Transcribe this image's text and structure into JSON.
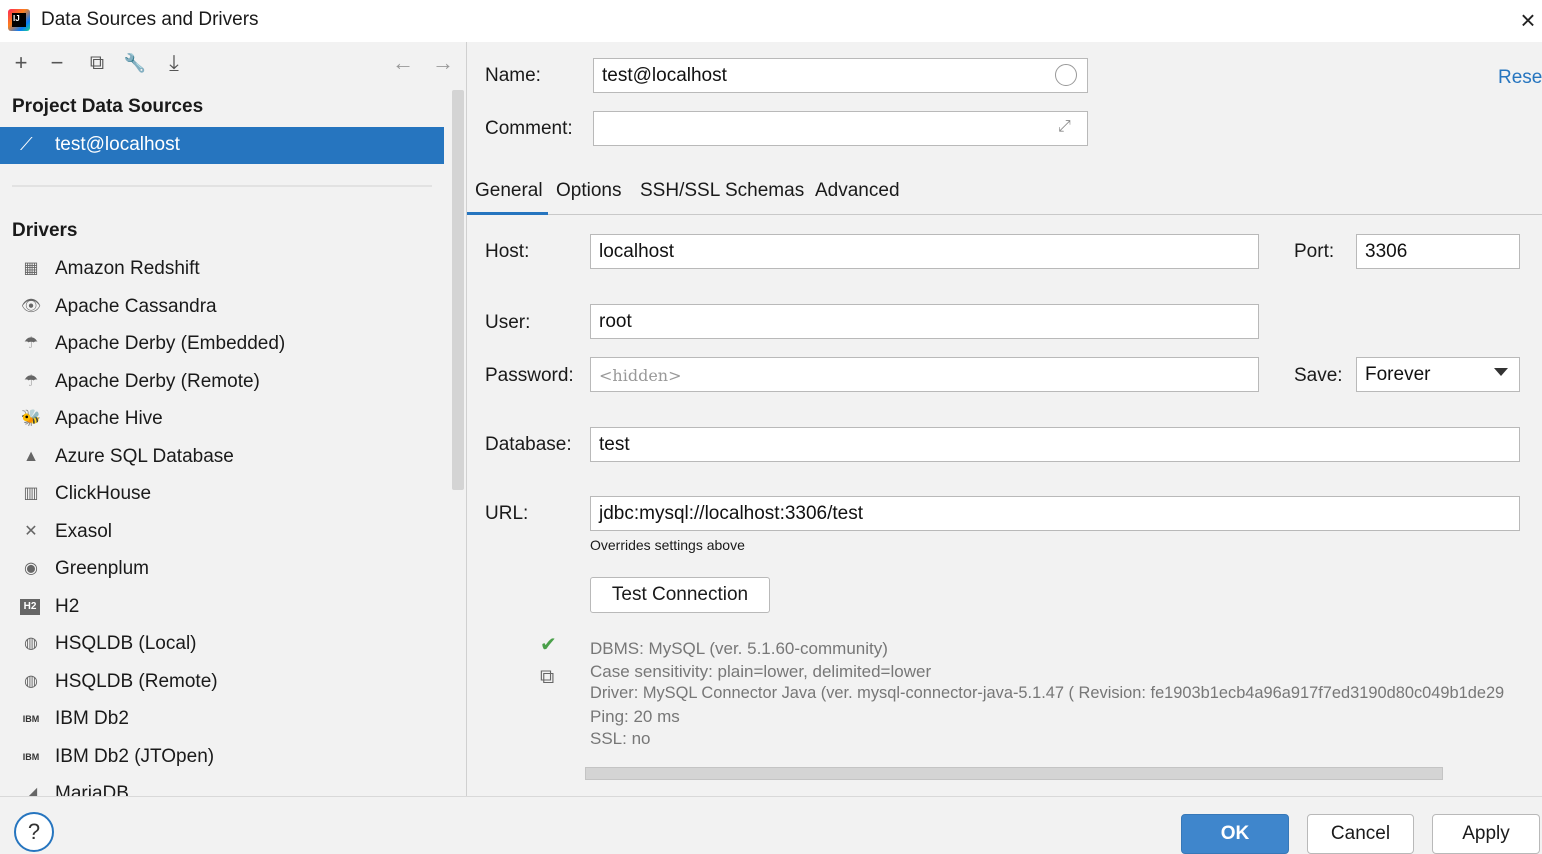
{
  "window": {
    "title": "Data Sources and Drivers",
    "close": "×"
  },
  "toolbar": {
    "add": "+",
    "remove": "−",
    "duplicate": "⧉",
    "settings": "🔧",
    "import": "⤓",
    "back": "←",
    "forward": "→"
  },
  "sidebar": {
    "project_title": "Project Data Sources",
    "selected_source": "test@localhost",
    "drivers_title": "Drivers",
    "drivers": [
      {
        "label": "Amazon Redshift",
        "icon": "▦"
      },
      {
        "label": "Apache Cassandra",
        "icon": "👁"
      },
      {
        "label": "Apache Derby (Embedded)",
        "icon": "☂"
      },
      {
        "label": "Apache Derby (Remote)",
        "icon": "☂"
      },
      {
        "label": "Apache Hive",
        "icon": "🐝"
      },
      {
        "label": "Azure SQL Database",
        "icon": "▲"
      },
      {
        "label": "ClickHouse",
        "icon": "▥"
      },
      {
        "label": "Exasol",
        "icon": "✕"
      },
      {
        "label": "Greenplum",
        "icon": "◉"
      },
      {
        "label": "H2",
        "icon": "H2"
      },
      {
        "label": "HSQLDB (Local)",
        "icon": "◍"
      },
      {
        "label": "HSQLDB (Remote)",
        "icon": "◍"
      },
      {
        "label": "IBM Db2",
        "icon": "IBM"
      },
      {
        "label": "IBM Db2 (JTOpen)",
        "icon": "IBM"
      },
      {
        "label": "MariaDB",
        "icon": "◢"
      }
    ]
  },
  "form": {
    "name_label": "Name:",
    "name_value": "test@localhost",
    "comment_label": "Comment:",
    "comment_value": "",
    "reset_label": "Reset",
    "tabs": [
      "General",
      "Options",
      "SSH/SSL",
      "Schemas",
      "Advanced"
    ],
    "host_label": "Host:",
    "host_value": "localhost",
    "port_label": "Port:",
    "port_value": "3306",
    "user_label": "User:",
    "user_value": "root",
    "password_label": "Password:",
    "password_placeholder": "<hidden>",
    "save_label": "Save:",
    "save_value": "Forever",
    "database_label": "Database:",
    "database_value": "test",
    "url_label": "URL:",
    "url_value": "jdbc:mysql://localhost:3306/test",
    "url_note": "Overrides settings above",
    "test_button": "Test Connection"
  },
  "connection_info": [
    "DBMS: MySQL (ver. 5.1.60-community)",
    "Case sensitivity: plain=lower, delimited=lower",
    "Driver: MySQL Connector Java (ver. mysql-connector-java-5.1.47 ( Revision: fe1903b1ecb4a96a917f7ed3190d80c049b1de29",
    "Ping: 20 ms",
    "SSL: no"
  ],
  "buttons": {
    "help": "?",
    "ok": "OK",
    "cancel": "Cancel",
    "apply": "Apply"
  },
  "colors": {
    "accent": "#2675bf",
    "selected_bg": "#2675bf",
    "ok_bg": "#3f86cc",
    "success": "#4aa04a"
  }
}
